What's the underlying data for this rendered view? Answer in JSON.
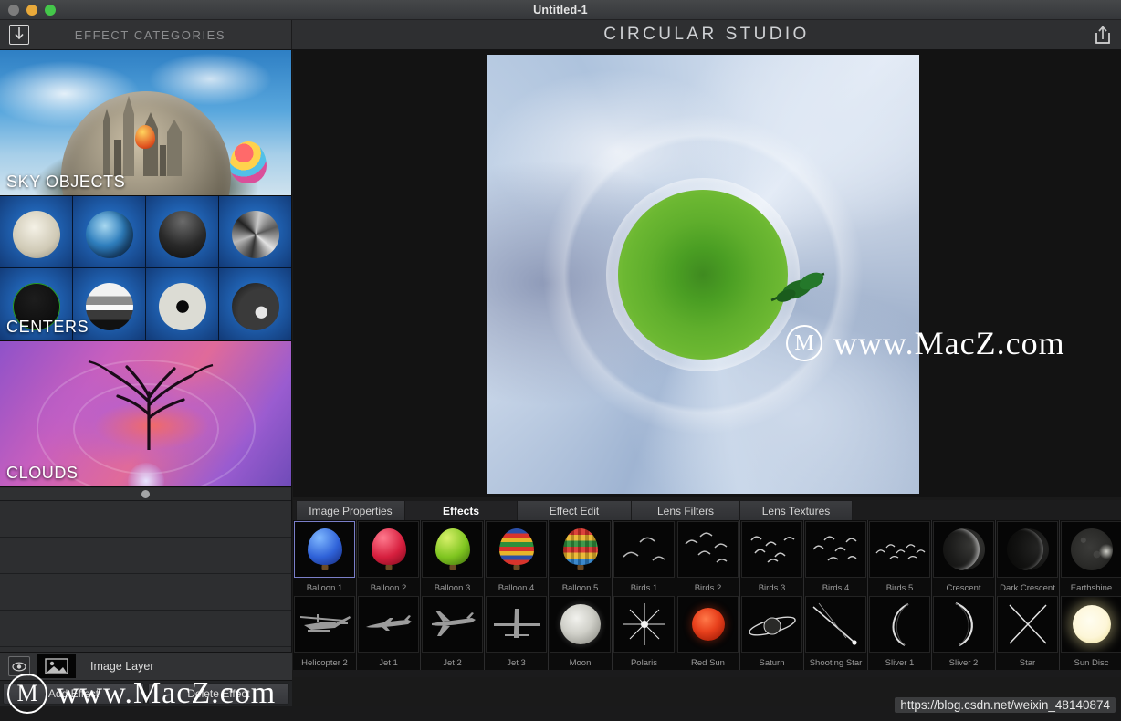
{
  "window": {
    "title": "Untitled-1",
    "traffic_lights": [
      "close-button",
      "minimize-button",
      "maximize-button"
    ]
  },
  "header": {
    "import_icon": "download-arrow-icon",
    "categories_label": "EFFECT CATEGORIES",
    "brand_part1": "CIRCULAR",
    "brand_part2": "STUDIO",
    "share_icon": "export-share-icon"
  },
  "sidebar": {
    "categories": [
      {
        "label": "SKY OBJECTS",
        "kind": "banner-sky"
      },
      {
        "label": "CENTERS",
        "kind": "grid-centers"
      },
      {
        "label": "CLOUDS",
        "kind": "banner-clouds"
      }
    ],
    "centers_thumbs": [
      "clock-planet",
      "earth-planet",
      "dark-dome-planet",
      "faceted-gray-planet",
      "wireframe-sphere-planet",
      "chrome-halftone-planet",
      "eyeball-planet",
      "rocky-dark-planet"
    ],
    "scroll_indicator": "scroll-position-dot",
    "empty_layer_rows": 4
  },
  "layer": {
    "visibility_icon": "eye-icon",
    "thumbnail_icon": "image-thumbnail-icon",
    "name": "Image Layer",
    "add_button": "Add Effect",
    "delete_button": "Delete Effect"
  },
  "canvas": {
    "image_description": "little-planet-stereographic-projection-green-field-clouds",
    "watermark_text": "www.MacZ.com",
    "watermark_mark": "M"
  },
  "tabs": [
    {
      "label": "Image Properties",
      "active": false
    },
    {
      "label": "Effects",
      "active": true
    },
    {
      "label": "Effect Edit",
      "active": false
    },
    {
      "label": "Lens Filters",
      "active": false
    },
    {
      "label": "Lens Textures",
      "active": false
    }
  ],
  "effects": {
    "row1": [
      {
        "label": "Balloon 1",
        "icon": "balloon-blue",
        "selected": true
      },
      {
        "label": "Balloon 2",
        "icon": "balloon-red",
        "selected": false
      },
      {
        "label": "Balloon 3",
        "icon": "balloon-green",
        "selected": false
      },
      {
        "label": "Balloon 4",
        "icon": "balloon-rainbow-striped",
        "selected": false
      },
      {
        "label": "Balloon 5",
        "icon": "balloon-rainbow-checkered",
        "selected": false
      },
      {
        "label": "Birds 1",
        "icon": "birds-flock-1",
        "selected": false
      },
      {
        "label": "Birds 2",
        "icon": "birds-flock-2",
        "selected": false
      },
      {
        "label": "Birds 3",
        "icon": "birds-flock-3",
        "selected": false
      },
      {
        "label": "Birds 4",
        "icon": "birds-flock-4",
        "selected": false
      },
      {
        "label": "Birds 5",
        "icon": "birds-flock-5",
        "selected": false
      },
      {
        "label": "Crescent",
        "icon": "moon-crescent",
        "selected": false
      },
      {
        "label": "Dark Crescent",
        "icon": "moon-dark-crescent",
        "selected": false
      },
      {
        "label": "Earthshine",
        "icon": "moon-earthshine",
        "selected": false
      }
    ],
    "row2": [
      {
        "label": "Helicopter 2",
        "icon": "helicopter-silhouette",
        "selected": false
      },
      {
        "label": "Jet 1",
        "icon": "jet-side-silhouette",
        "selected": false
      },
      {
        "label": "Jet 2",
        "icon": "jet-angled-silhouette",
        "selected": false
      },
      {
        "label": "Jet 3",
        "icon": "jet-front-silhouette",
        "selected": false
      },
      {
        "label": "Moon",
        "icon": "moon-full",
        "selected": false
      },
      {
        "label": "Polaris",
        "icon": "star-polaris-flare",
        "selected": false
      },
      {
        "label": "Red Sun",
        "icon": "sun-red-disc",
        "selected": false
      },
      {
        "label": "Saturn",
        "icon": "planet-saturn-rings",
        "selected": false
      },
      {
        "label": "Shooting Star",
        "icon": "shooting-star-streak",
        "selected": false
      },
      {
        "label": "Sliver 1",
        "icon": "moon-sliver-1",
        "selected": false
      },
      {
        "label": "Sliver 2",
        "icon": "moon-sliver-2",
        "selected": false
      },
      {
        "label": "Star",
        "icon": "star-four-point",
        "selected": false
      },
      {
        "label": "Sun Disc",
        "icon": "sun-disc-pale",
        "selected": false
      }
    ]
  },
  "overlay": {
    "watermark_text": "www.MacZ.com",
    "watermark_mark": "M",
    "url": "https://blog.csdn.net/weixin_48140874"
  },
  "colors": {
    "accent_selection": "#7a7ec8",
    "window_chrome": "#35373a",
    "panel_bg": "#2a2b2d",
    "grid_bg": "#1b1b1c",
    "text_primary": "#dcdcdc",
    "text_muted": "#8b8c8e"
  }
}
